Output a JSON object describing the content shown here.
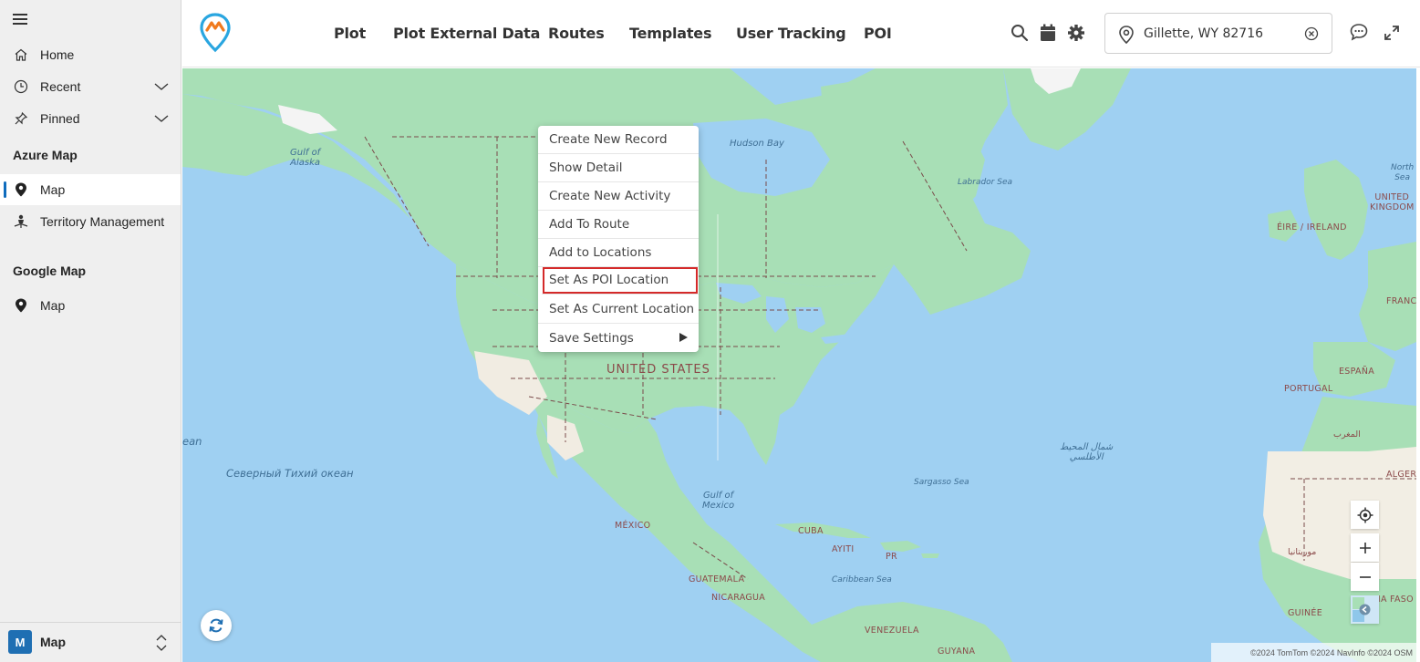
{
  "sidebar": {
    "items": [
      {
        "label": "Home",
        "icon": "home-icon"
      },
      {
        "label": "Recent",
        "icon": "clock-icon"
      },
      {
        "label": "Pinned",
        "icon": "pin-icon"
      }
    ],
    "sections": [
      {
        "title": "Azure Map",
        "items": [
          {
            "label": "Map",
            "icon": "map-pin-icon",
            "active": true
          },
          {
            "label": "Territory Management",
            "icon": "territory-icon"
          }
        ]
      },
      {
        "title": "Google Map",
        "items": [
          {
            "label": "Map",
            "icon": "map-pin-icon"
          }
        ]
      }
    ],
    "footer": {
      "badge": "M",
      "label": "Map"
    }
  },
  "header": {
    "tabs": [
      "Plot",
      "Plot External Data",
      "Routes",
      "Templates",
      "User Tracking",
      "POI"
    ],
    "location_value": "Gillette, WY 82716",
    "icons": [
      "search-icon",
      "calendar-icon",
      "gear-icon",
      "chat-icon",
      "expand-icon"
    ]
  },
  "map": {
    "labels": {
      "gulf_alaska": "Gulf of\nAlaska",
      "hudson_bay": "Hudson Bay",
      "labrador_sea": "Labrador Sea",
      "north_sea": "North\nSea",
      "united_states": "UNITED STATES",
      "mexico": "MÉXICO",
      "gulf_mexico": "Gulf of\nMexico",
      "cuba": "CUBA",
      "ayiti": "AYITI",
      "pr": "PR",
      "caribbean_sea": "Caribbean Sea",
      "guatemala": "GUATEMALA",
      "nicaragua": "NICARAGUA",
      "venezuela": "VENEZUELA",
      "guyana": "GUYANA",
      "sargasso_sea": "Sargasso Sea",
      "north_atlantic_ar": "شمال المحيط\nالأطلسي",
      "pacific_ru": "Северный Тихий океан",
      "ean": "ean",
      "united_kingdom": "UNITED\nKINGDOM",
      "eire": "ÉIRE / IRELAND",
      "france": "FRANC",
      "espana": "ESPAÑA",
      "portugal": "PORTUGAL",
      "maghreb": "المغرب",
      "alger": "ALGER",
      "mauritania": "موريتانيا",
      "burkina": "RKINA FASO",
      "guinee": "GUINÉE"
    },
    "attribution": "©2024 TomTom ©2024 NavInfo ©2024 OSM"
  },
  "context_menu": {
    "items": [
      {
        "label": "Create New Record"
      },
      {
        "label": "Show Detail"
      },
      {
        "label": "Create New Activity"
      },
      {
        "label": "Add To Route"
      },
      {
        "label": "Add to Locations"
      },
      {
        "label": "Set As POI Location",
        "highlighted": true
      },
      {
        "label": "Set As Current Location"
      },
      {
        "label": "Save Settings",
        "has_submenu": true
      }
    ]
  },
  "colors": {
    "land": "#a8dfb6",
    "water": "#9fd0f2",
    "accent": "#0f6cbd",
    "highlight": "#d42a2a"
  }
}
